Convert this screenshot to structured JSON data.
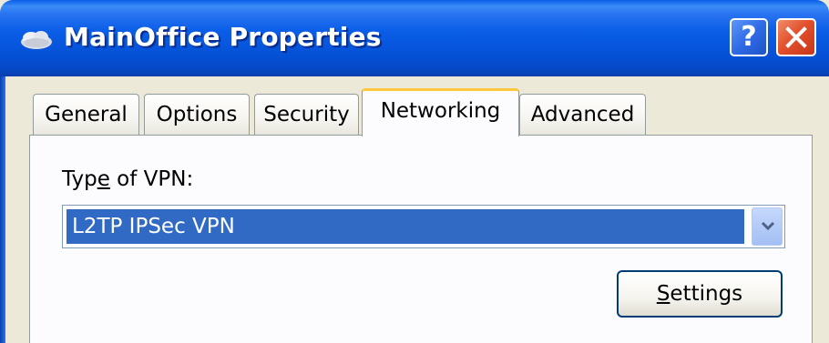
{
  "window": {
    "title": "MainOffice Properties",
    "help_label": "?",
    "colors": {
      "titlebar": "#0b5ee7",
      "close": "#e2502c",
      "dialog_bg": "#ece9d8",
      "selection": "#316ac5",
      "active_tab_accent": "#ffc83c"
    }
  },
  "tabs": [
    {
      "label": "General"
    },
    {
      "label": "Options"
    },
    {
      "label": "Security"
    },
    {
      "label": "Networking",
      "active": true
    },
    {
      "label": "Advanced"
    }
  ],
  "networking": {
    "vpn_type_label_pre": "Typ",
    "vpn_type_label_mnemonic": "e",
    "vpn_type_label_post": " of VPN:",
    "vpn_type_value": "L2TP IPSec VPN",
    "settings_mnemonic": "S",
    "settings_rest": "ettings"
  },
  "icons": {
    "title": "network-connection-icon",
    "help": "help-icon",
    "close": "close-icon",
    "dropdown": "chevron-down-icon"
  }
}
